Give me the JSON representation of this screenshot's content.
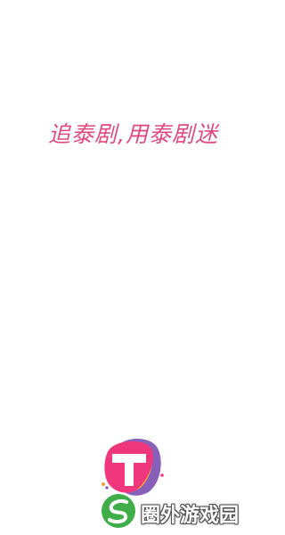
{
  "splash": {
    "slogan": "追泰剧,用泰剧迷",
    "slogan_color": "#e0487e",
    "logo_icon": "tai-ju-mi-app-logo-icon",
    "logo_colors": [
      "#f0367c",
      "#f6a23a",
      "#7b4fb3",
      "#ffffff"
    ]
  },
  "watermark": {
    "text": "圈外游戏园",
    "icon": "leaf-s-icon",
    "icon_colors": [
      "#3fae49",
      "#ffffff"
    ]
  }
}
